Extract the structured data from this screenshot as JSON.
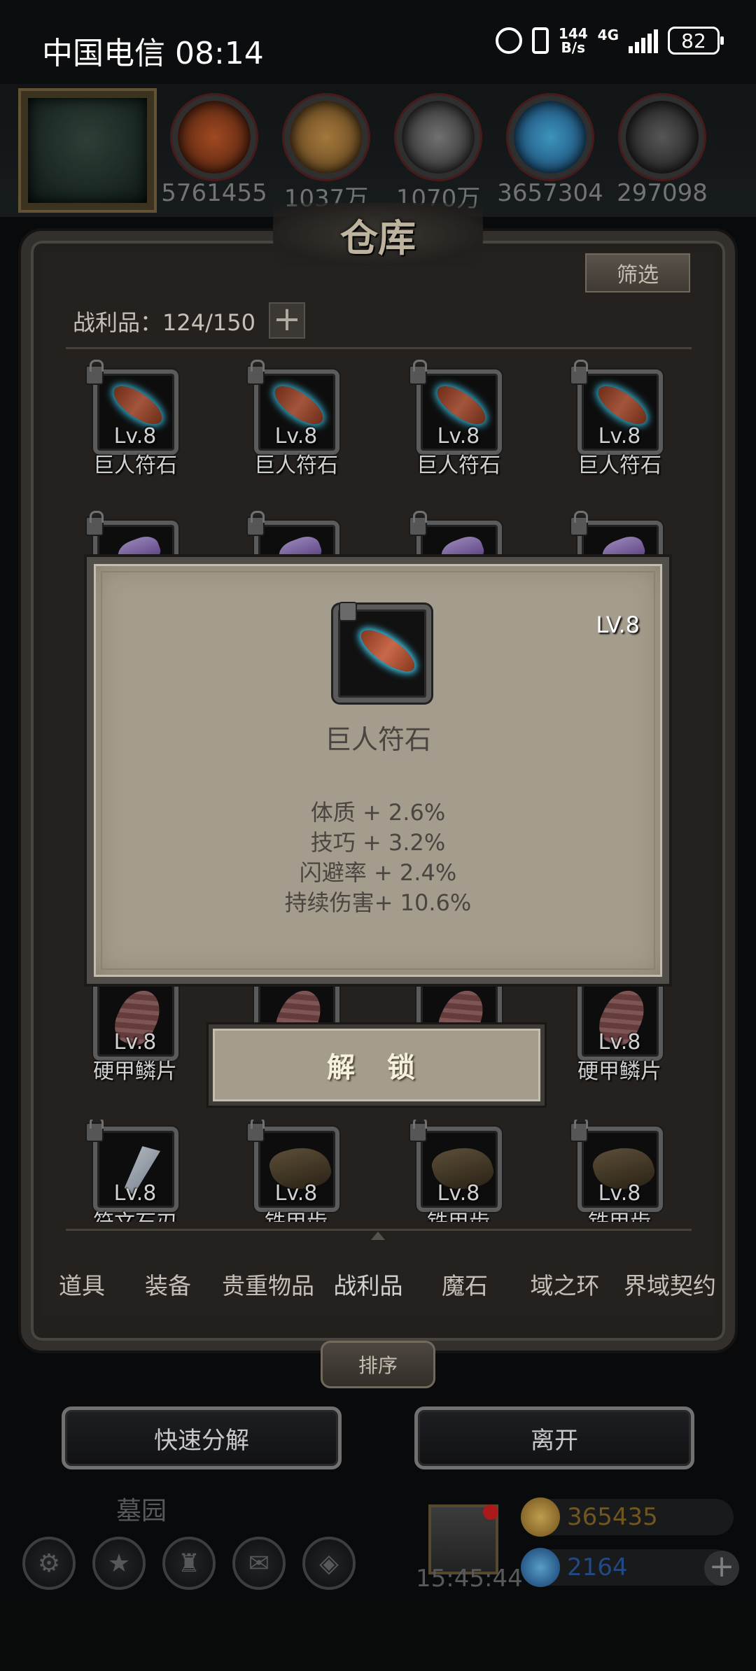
{
  "status_bar": {
    "carrier_time": "中国电信 08:14",
    "net_speed_value": "144",
    "net_speed_unit": "B/s",
    "network": "4G",
    "battery": "82"
  },
  "hud": {
    "resources": [
      "5761455",
      "1037万",
      "1070万",
      "3657304",
      "297098"
    ]
  },
  "warehouse": {
    "title": "仓库",
    "filter_label": "筛选",
    "loot_label": "战利品：124/150",
    "add_label": "+",
    "items": [
      {
        "lv": "Lv.8",
        "name": "巨人符石",
        "kind": "blue"
      },
      {
        "lv": "Lv.8",
        "name": "巨人符石",
        "kind": "blue"
      },
      {
        "lv": "Lv.8",
        "name": "巨人符石",
        "kind": "blue"
      },
      {
        "lv": "Lv.8",
        "name": "巨人符石",
        "kind": "blue"
      },
      {
        "lv": "Lv.8",
        "name": "硬甲鳞片",
        "kind": "scale"
      },
      {
        "lv": "Lv.8",
        "name": "硬甲鳞片",
        "kind": "scale"
      },
      {
        "lv": "Lv.8",
        "name": "符文石刃",
        "kind": "blade"
      },
      {
        "lv": "Lv.8",
        "name": "铁甲齿",
        "kind": "claw"
      },
      {
        "lv": "Lv.8",
        "name": "铁甲齿",
        "kind": "claw"
      },
      {
        "lv": "Lv.8",
        "name": "铁甲齿",
        "kind": "claw"
      }
    ],
    "tabs": [
      "道具",
      "装备",
      "贵重物品",
      "战利品",
      "魔石",
      "域之环",
      "界域契约"
    ],
    "active_tab": "战利品",
    "sort_label": "排序",
    "quick_decompose_label": "快速分解",
    "leave_label": "离开"
  },
  "popup": {
    "level": "LV.8",
    "item_name": "巨人符石",
    "stats": [
      "体质 + 2.6%",
      "技巧 + 3.2%",
      "闪避率 + 2.4%",
      "持续伤害+ 10.6%"
    ],
    "unlock_label": "解 锁"
  },
  "bottom_hud": {
    "location": "墓园",
    "timer": "15:45:44",
    "gold": "365435",
    "gems": "2164",
    "add_label": "+"
  },
  "colors": {
    "popup_bg": "#a49c8c",
    "gold_text": "#8a6a2a",
    "gem_text": "#2a5aa0"
  }
}
